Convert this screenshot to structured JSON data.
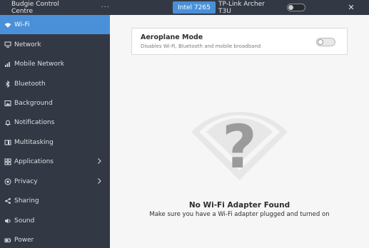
{
  "header": {
    "title": "Budgie Control Centre",
    "menu_glyph": "···",
    "tabs": [
      {
        "label": "Intel 7265",
        "active": true
      },
      {
        "label": "TP-Link Archer T3U",
        "active": false
      }
    ],
    "wifi_switch_on": false,
    "close_glyph": "✕"
  },
  "sidebar": {
    "items": [
      {
        "label": "Wi-Fi",
        "icon": "wifi-icon",
        "active": true
      },
      {
        "label": "Network",
        "icon": "network-icon"
      },
      {
        "label": "Mobile Network",
        "icon": "mobile-network-icon"
      },
      {
        "label": "Bluetooth",
        "icon": "bluetooth-icon"
      },
      {
        "label": "Background",
        "icon": "background-icon"
      },
      {
        "label": "Notifications",
        "icon": "notifications-icon"
      },
      {
        "label": "Multitasking",
        "icon": "multitasking-icon"
      },
      {
        "label": "Applications",
        "icon": "applications-icon",
        "chevron": true
      },
      {
        "label": "Privacy",
        "icon": "privacy-icon",
        "chevron": true
      },
      {
        "label": "Sharing",
        "icon": "sharing-icon"
      },
      {
        "label": "Sound",
        "icon": "sound-icon"
      },
      {
        "label": "Power",
        "icon": "power-icon"
      }
    ]
  },
  "main": {
    "aeroplane": {
      "title": "Aeroplane Mode",
      "subtitle": "Disables Wi-Fi, Bluetooth and mobile broadband",
      "enabled": false
    },
    "empty_state": {
      "icon": "wifi-question-icon",
      "glyph": "?",
      "title": "No Wi-Fi Adapter Found",
      "subtitle": "Make sure you have a Wi-Fi adapter plugged and turned on"
    }
  },
  "colors": {
    "sidebar_bg": "#333944",
    "accent": "#4a90d9",
    "main_bg": "#f6f6f6"
  }
}
